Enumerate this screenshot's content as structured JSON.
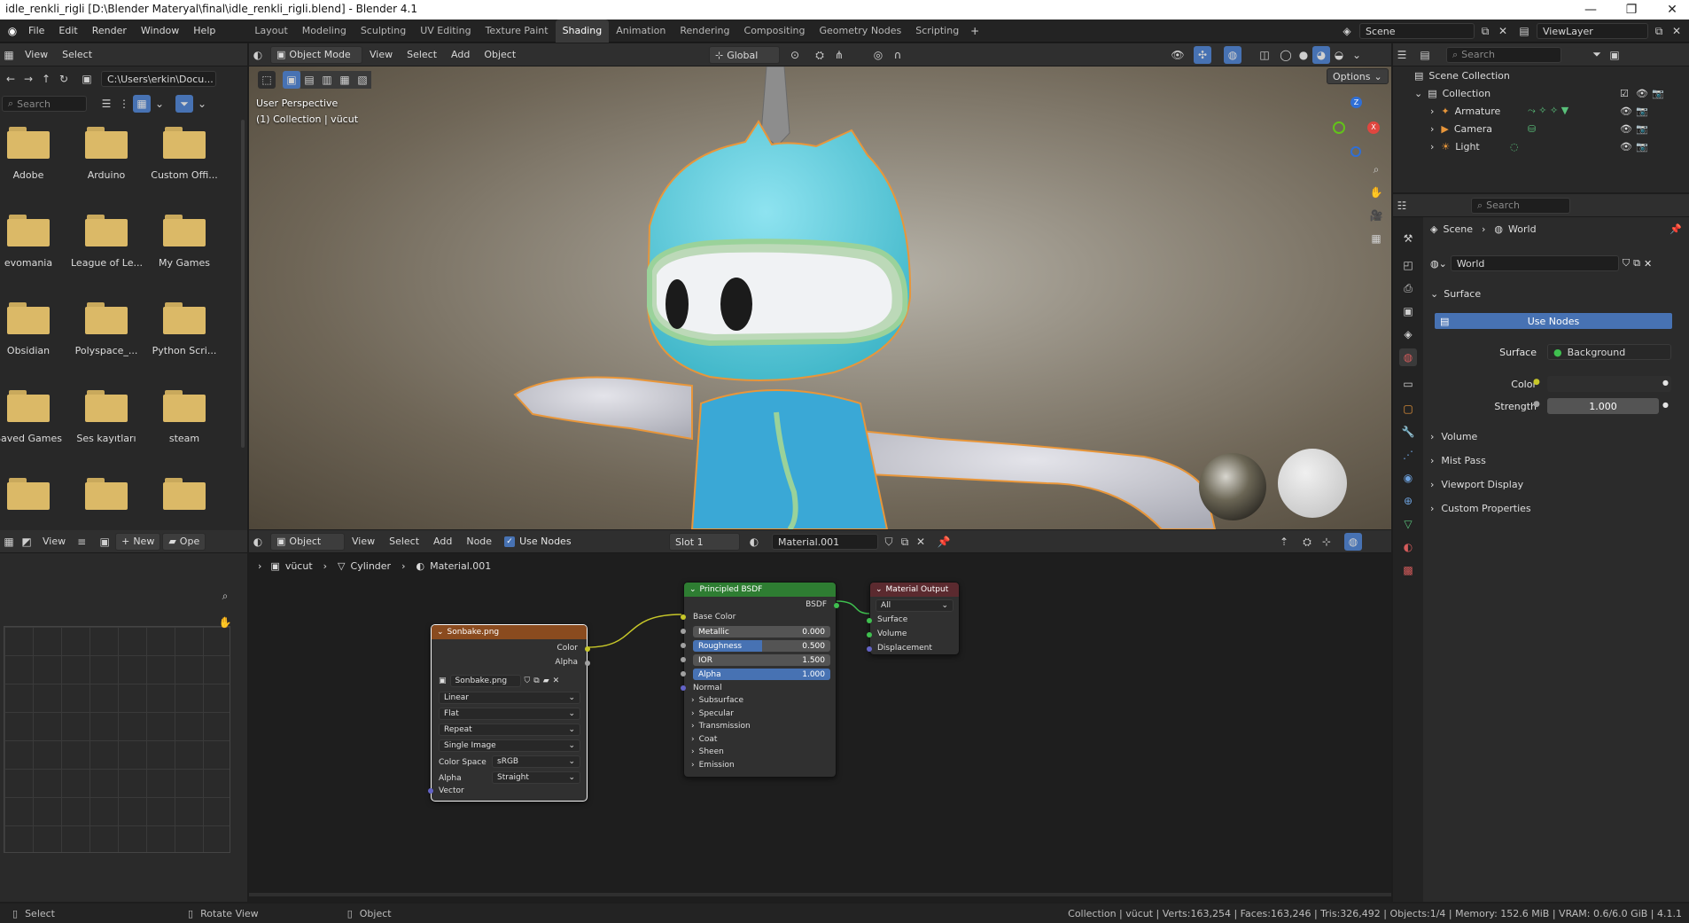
{
  "window": {
    "title": "idle_renkli_rigli [D:\\Blender Materyal\\final\\idle_renkli_rigli.blend] - Blender 4.1",
    "minimize": "—",
    "restore": "❐",
    "close": "✕"
  },
  "menu": [
    "File",
    "Edit",
    "Render",
    "Window",
    "Help"
  ],
  "workspaces": [
    "Layout",
    "Modeling",
    "Sculpting",
    "UV Editing",
    "Texture Paint",
    "Shading",
    "Animation",
    "Rendering",
    "Compositing",
    "Geometry Nodes",
    "Scripting"
  ],
  "active_workspace": "Shading",
  "scene": {
    "name": "Scene",
    "view_layer": "ViewLayer"
  },
  "file_browser": {
    "menu_view": "View",
    "menu_select": "Select",
    "path": "C:\\Users\\erkin\\Docu...",
    "search_placeholder": "Search",
    "folders": [
      "Adobe",
      "Arduino",
      "Custom Offi...",
      "evomania",
      "League of Le...",
      "My Games",
      "Obsidian",
      "Polyspace_...",
      "Python Scri...",
      "Saved Games",
      "Ses kayıtları",
      "steam",
      "",
      "",
      ""
    ]
  },
  "image_editor": {
    "view": "View",
    "new": "New",
    "open": "Ope"
  },
  "viewport": {
    "mode": "Object Mode",
    "view": "View",
    "select": "Select",
    "add": "Add",
    "object": "Object",
    "orientation": "Global",
    "options": "Options",
    "overlay_line1": "User Perspective",
    "overlay_line2": "(1) Collection | vücut",
    "gizmo_z": "Z",
    "gizmo_x": "X"
  },
  "node_editor": {
    "type": "Object",
    "view": "View",
    "select": "Select",
    "add": "Add",
    "node": "Node",
    "use_nodes": "Use Nodes",
    "slot": "Slot 1",
    "material": "Material.001",
    "breadcrumb": [
      "vücut",
      "Cylinder",
      "Material.001"
    ],
    "image_node": {
      "title": "Sonbake.png",
      "out_color": "Color",
      "out_alpha": "Alpha",
      "image": "Sonbake.png",
      "interpolation": "Linear",
      "projection": "Flat",
      "extension": "Repeat",
      "source": "Single Image",
      "color_space_label": "Color Space",
      "color_space": "sRGB",
      "alpha_label": "Alpha",
      "alpha": "Straight",
      "in_vector": "Vector"
    },
    "bsdf_node": {
      "title": "Principled BSDF",
      "out": "BSDF",
      "base_color": "Base Color",
      "metallic": {
        "label": "Metallic",
        "value": "0.000",
        "fraction": 0.0
      },
      "roughness": {
        "label": "Roughness",
        "value": "0.500",
        "fraction": 0.5
      },
      "ior": {
        "label": "IOR",
        "value": "1.500",
        "fraction": 0.0
      },
      "alpha": {
        "label": "Alpha",
        "value": "1.000",
        "fraction": 1.0
      },
      "normal": "Normal",
      "panels": [
        "Subsurface",
        "Specular",
        "Transmission",
        "Coat",
        "Sheen",
        "Emission"
      ]
    },
    "output_node": {
      "title": "Material Output",
      "target": "All",
      "surface": "Surface",
      "volume": "Volume",
      "displacement": "Displacement"
    }
  },
  "outliner": {
    "search_placeholder": "Search",
    "scene_collection": "Scene Collection",
    "collection": "Collection",
    "items": [
      "Armature",
      "Camera",
      "Light"
    ]
  },
  "properties": {
    "search_placeholder": "Search",
    "breadcrumb_scene": "Scene",
    "breadcrumb_world": "World",
    "world_name": "World",
    "surface_panel": "Surface",
    "use_nodes": "Use Nodes",
    "surface_label": "Surface",
    "surface_value": "Background",
    "color_label": "Color",
    "strength_label": "Strength",
    "strength_value": "1.000",
    "sections": [
      "Volume",
      "Mist Pass",
      "Viewport Display",
      "Custom Properties"
    ]
  },
  "statusbar": {
    "select": "Select",
    "rotate": "Rotate View",
    "object": "Object",
    "stats": "Collection | vücut | Verts:163,254 | Faces:163,246 | Tris:326,492 | Objects:1/4 | Memory: 152.6 MiB | VRAM: 0.6/6.0 GiB | 4.1.1"
  },
  "colors": {
    "accent": "#4772b3",
    "selection_outline": "#e8963a",
    "shader_header": "#2e7d32",
    "image_header": "#8a4b1f",
    "output_header": "#5b2a2f"
  }
}
